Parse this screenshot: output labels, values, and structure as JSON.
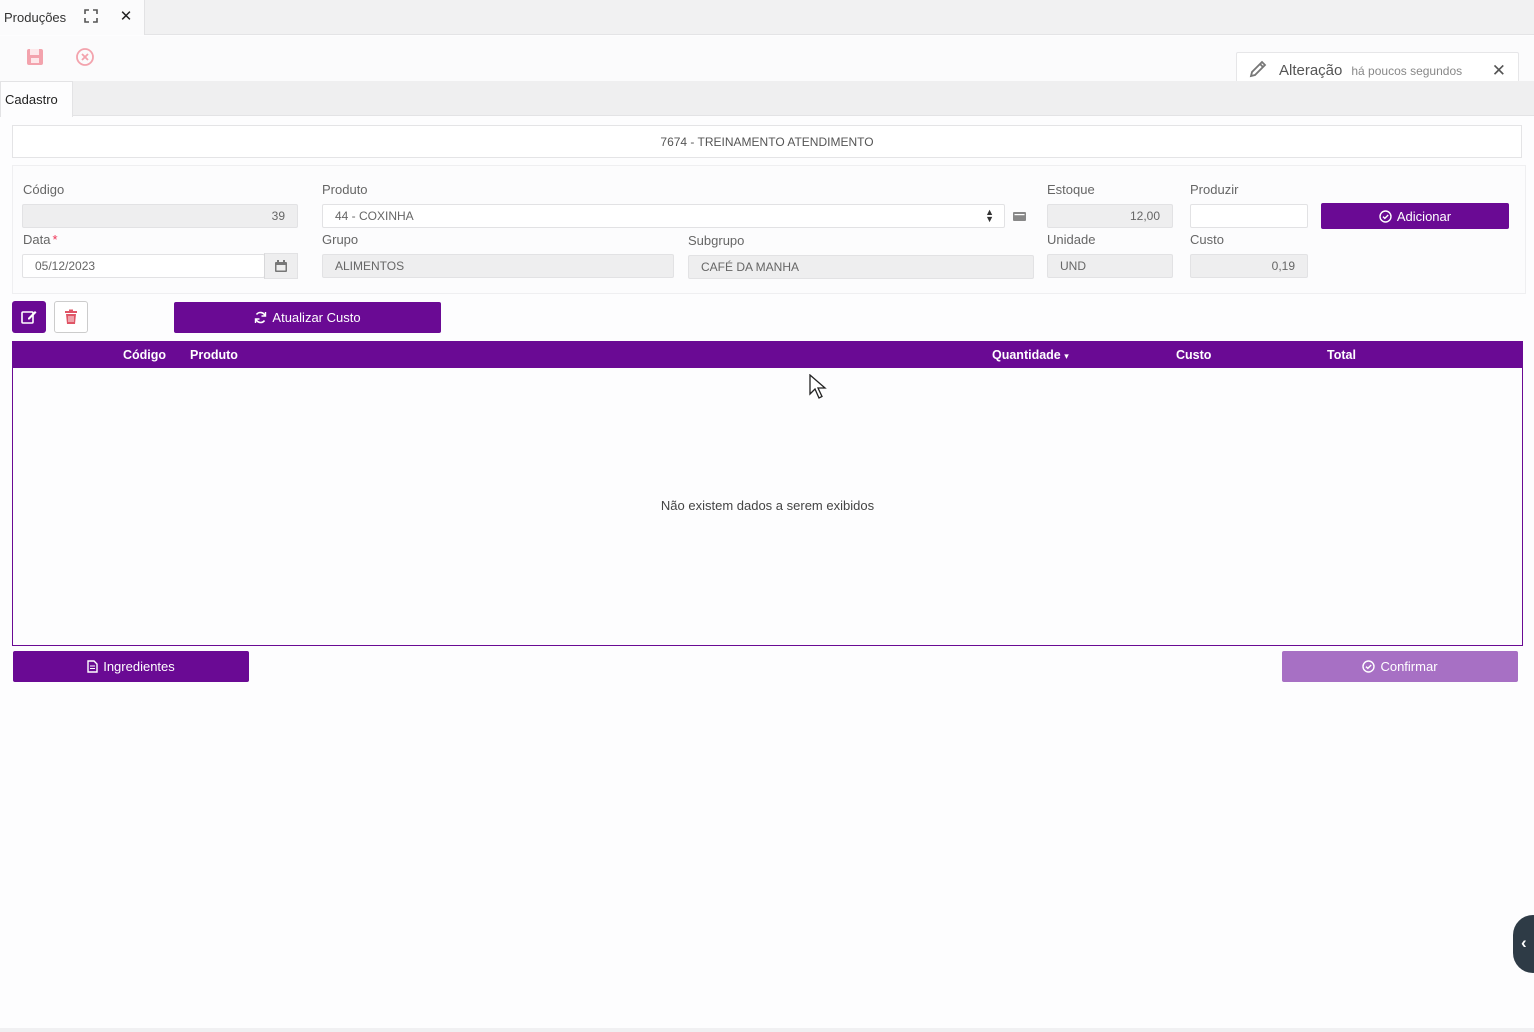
{
  "tab": {
    "title": "Produções"
  },
  "notification": {
    "title": "Alteração",
    "time": "há poucos segundos"
  },
  "subtabs": [
    {
      "label": "Cadastro"
    }
  ],
  "header": {
    "title": "7674 - TREINAMENTO ATENDIMENTO"
  },
  "form": {
    "codigo": {
      "label": "Código",
      "value": "39"
    },
    "produto": {
      "label": "Produto",
      "value": "44 - COXINHA"
    },
    "estoque": {
      "label": "Estoque",
      "value": "12,00"
    },
    "produzir": {
      "label": "Produzir",
      "value": ""
    },
    "adicionar_label": "Adicionar",
    "data": {
      "label": "Data",
      "required": "*",
      "value": "05/12/2023"
    },
    "grupo": {
      "label": "Grupo",
      "value": "ALIMENTOS"
    },
    "subgrupo": {
      "label": "Subgrupo",
      "value": "CAFÉ DA MANHA"
    },
    "unidade": {
      "label": "Unidade",
      "value": "UND"
    },
    "custo": {
      "label": "Custo",
      "value": "0,19"
    }
  },
  "actions": {
    "atualizar_custo": "Atualizar Custo"
  },
  "grid": {
    "columns": [
      "Código",
      "Produto",
      "Quantidade",
      "Custo",
      "Total"
    ],
    "sort_indicator": "▾",
    "empty_text": "Não existem dados a serem exibidos"
  },
  "footer": {
    "ingredientes": "Ingredientes",
    "confirmar": "Confirmar"
  },
  "colors": {
    "primary": "#6a0a94",
    "primary_light": "#a770c4",
    "danger": "#e05566"
  }
}
